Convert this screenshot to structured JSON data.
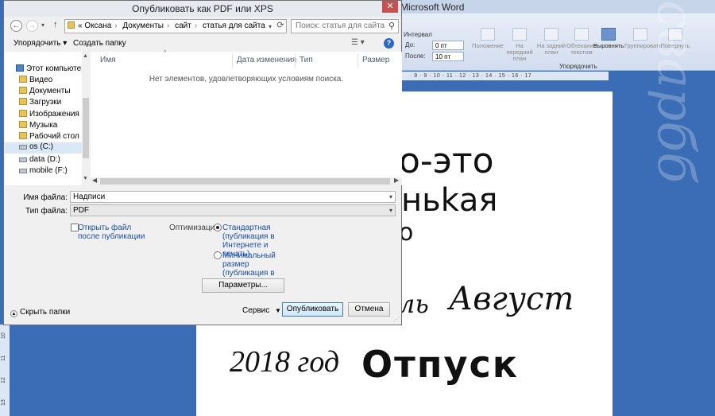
{
  "word": {
    "title_fragment": "Microsoft Word",
    "ribbon": {
      "interval_label": "Интервал",
      "before_label": "До:",
      "before_value": "0 пт",
      "after_label": "После:",
      "after_value": "10 пт",
      "buttons": [
        "Положение",
        "На передний план",
        "На задний план",
        "Обтекание текстом",
        "Выровнять",
        "Группировать",
        "Повернуть"
      ],
      "group_label": "Упорядочить"
    },
    "ruler_text": "· 8 · 9 · 10 · 11 · 12 · 13 · 14 · 15 · 16 · 17",
    "vruler_numbers": [
      "10",
      "11",
      "12",
      "13"
    ],
    "doc_lines": {
      "line1": "о-это",
      "line2": "ньkая",
      "line3": "о",
      "line4a": "ль",
      "line4b": "Август",
      "line5a": "2018 год",
      "line5b": "Отпуск"
    },
    "watermark": "сварбб"
  },
  "dialog": {
    "title": "Опубликовать как PDF или XPS",
    "close_label": "✕",
    "address": {
      "prefix": "«",
      "parts": [
        "Оксана",
        "Документы",
        "сайт",
        "статья для сайта"
      ]
    },
    "search_placeholder": "Поиск: статья для сайта",
    "toolbar": {
      "organize": "Упорядочить ▾",
      "new_folder": "Создать папку",
      "view": "☰ ▾",
      "help": "?"
    },
    "nav_tree": [
      {
        "label": "Этот компьютер",
        "icon": "computer-icon"
      },
      {
        "label": "Видео",
        "icon": "folder-icon"
      },
      {
        "label": "Документы",
        "icon": "folder-icon"
      },
      {
        "label": "Загрузки",
        "icon": "folder-icon"
      },
      {
        "label": "Изображения",
        "icon": "folder-icon"
      },
      {
        "label": "Музыка",
        "icon": "folder-icon"
      },
      {
        "label": "Рабочий стол",
        "icon": "folder-icon"
      },
      {
        "label": "os (C:)",
        "icon": "drive-icon"
      },
      {
        "label": "data (D:)",
        "icon": "drive-icon"
      },
      {
        "label": "mobile (F:)",
        "icon": "drive-icon"
      }
    ],
    "columns": [
      "Имя",
      "Дата изменения",
      "Тип",
      "Размер"
    ],
    "empty_message": "Нет элементов, удовлетворяющих условиям поиска.",
    "filename_label": "Имя файла:",
    "filename_value": "Надписи",
    "filetype_label": "Тип файла:",
    "filetype_value": "PDF",
    "open_after_label": "Открыть файл после публикации",
    "optimization_label": "Оптимизация:",
    "opt_standard": "Стандартная (публикация в Интернете и печать)",
    "opt_minimal": "Минимальный размер (публикация в Интернете)",
    "params_button": "Параметры...",
    "hide_folders": "Скрыть папки",
    "service_label": "Сервис",
    "publish_button": "Опубликовать",
    "cancel_button": "Отмена"
  }
}
